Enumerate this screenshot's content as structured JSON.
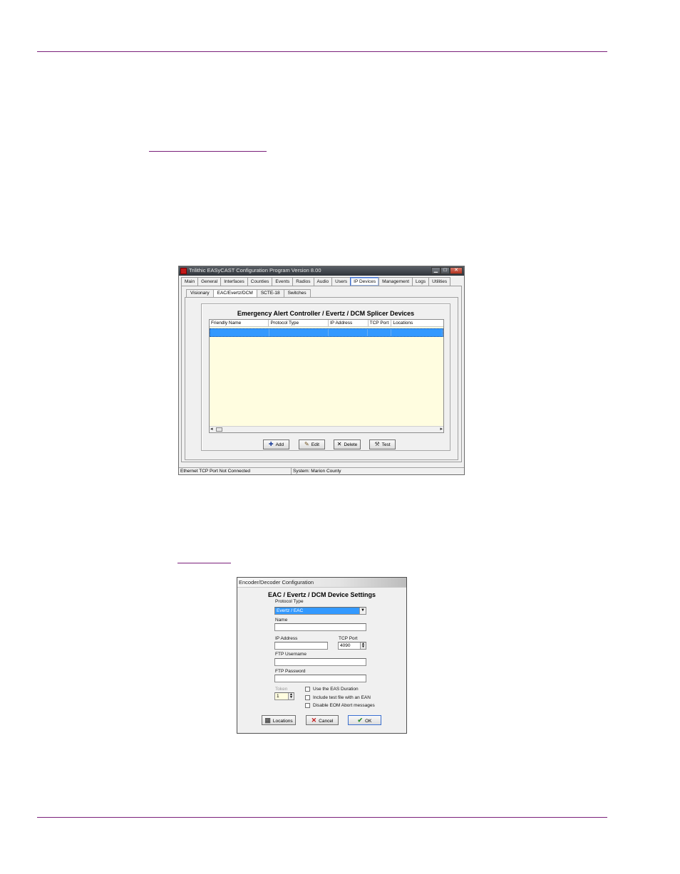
{
  "main_window": {
    "title": "Trilithic EASyCAST Configuration Program Version 8.00",
    "window_buttons": {
      "minimize": "▁",
      "maximize": "□",
      "close": "✕"
    },
    "tabs": [
      {
        "label": "Main"
      },
      {
        "label": "General"
      },
      {
        "label": "Interfaces"
      },
      {
        "label": "Counties"
      },
      {
        "label": "Events"
      },
      {
        "label": "Radios"
      },
      {
        "label": "Audio"
      },
      {
        "label": "Users"
      },
      {
        "label": "IP Devices"
      },
      {
        "label": "Management"
      },
      {
        "label": "Logs"
      },
      {
        "label": "Utilities"
      }
    ],
    "active_tab": "IP Devices",
    "subtabs": [
      {
        "label": "Visionary"
      },
      {
        "label": "EAC/Evertz/DCM"
      },
      {
        "label": "SCTE-18"
      },
      {
        "label": "Switches"
      }
    ],
    "active_subtab": "EAC/Evertz/DCM",
    "group_title": "Emergency Alert Controller / Evertz / DCM Splicer Devices",
    "columns": [
      "Friendly Name",
      "Protocol Type",
      "IP Address",
      "TCP Port",
      "Locations"
    ],
    "scroll": {
      "left": "◂",
      "right": "▸"
    },
    "buttons": {
      "add": "Add",
      "edit": "Edit",
      "delete": "Delete",
      "test": "Test"
    },
    "status_left": "Ethernet TCP Port Not Connected",
    "status_right": "System: Marion County"
  },
  "dialog": {
    "title": "Encoder/Decoder Configuration",
    "heading": "EAC / Evertz / DCM Device Settings",
    "protocol_label": "Protocol Type",
    "protocol_value": "Evertz / EAC",
    "name_label": "Name",
    "name_value": "",
    "ip_label": "IP Address",
    "ip_value": "",
    "tcp_label": "TCP Port",
    "tcp_value": "4090",
    "ftp_user_label": "FTP Username",
    "ftp_user_value": "",
    "ftp_pass_label": "FTP Password",
    "ftp_pass_value": "",
    "token_label": "Token",
    "token_value": "1",
    "options": [
      {
        "label": "Use the EAS Duration",
        "checked": false
      },
      {
        "label": "Include test file with an EAN",
        "checked": false
      },
      {
        "label": "Disable EOM Abort messages",
        "checked": false
      }
    ],
    "buttons": {
      "locations": "Locations",
      "cancel": "Cancel",
      "ok": "OK"
    }
  },
  "colors": {
    "accent_rule": "#7a1f7a",
    "selection": "#3399ff",
    "list_bg": "#fffde0"
  }
}
